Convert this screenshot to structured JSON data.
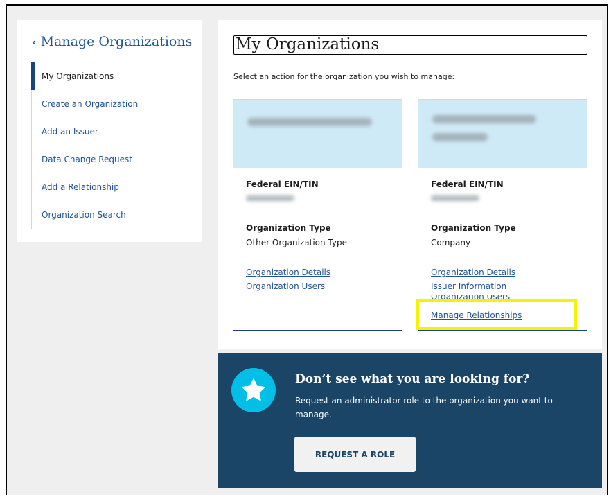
{
  "sidenav": {
    "back_label": "Manage Organizations",
    "items": [
      {
        "label": "My Organizations",
        "active": true
      },
      {
        "label": "Create an Organization"
      },
      {
        "label": "Add an Issuer"
      },
      {
        "label": "Data Change Request"
      },
      {
        "label": "Add a Relationship"
      },
      {
        "label": "Organization Search"
      }
    ]
  },
  "main": {
    "title": "My Organizations",
    "subtitle": "Select an action for the organization you wish to manage:",
    "cards": [
      {
        "ein_label": "Federal EIN/TIN",
        "type_label": "Organization Type",
        "type_value": "Other Organization Type",
        "links": [
          "Organization Details",
          "Organization Users"
        ]
      },
      {
        "ein_label": "Federal EIN/TIN",
        "type_label": "Organization Type",
        "type_value": "Company",
        "links": [
          "Organization Details",
          "Issuer Information",
          "Organization Users",
          "Manage Relationships"
        ]
      }
    ]
  },
  "promo": {
    "icon": "star-icon",
    "heading": "Don’t see what you are looking for?",
    "description": "Request an administrator role to the organization you want to manage.",
    "button_label": "REQUEST A ROLE"
  },
  "colors": {
    "link": "#205493",
    "card_header": "#cfeaf7",
    "promo_bg": "#1b4566",
    "star_circle": "#02bfe7",
    "highlight": "#f6f200"
  }
}
